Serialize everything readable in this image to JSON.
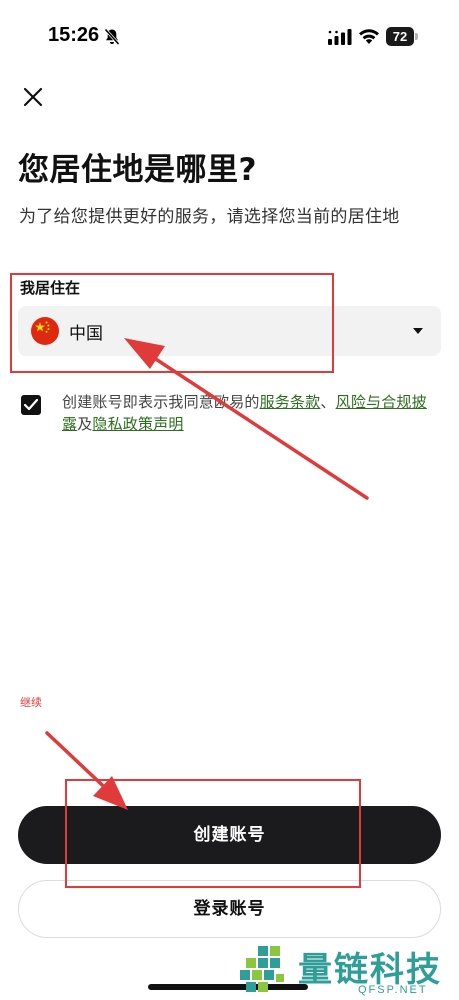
{
  "status_bar": {
    "time": "15:26",
    "battery": "72",
    "icons": [
      "bell-off-icon",
      "signal-icon",
      "wifi-icon",
      "battery-icon"
    ]
  },
  "header": {
    "close_icon": "close-icon",
    "title": "您居住地是哪里?",
    "subtitle": "为了给您提供更好的服务，请选择您当前的居住地"
  },
  "residence": {
    "label": "我居住在",
    "selected_country": "中国",
    "flag_icon": "china-flag-icon",
    "caret_icon": "caret-down-icon"
  },
  "agreement": {
    "checked": true,
    "prefix": "创建账号即表示我同意欧易的",
    "terms_link": "服务条款",
    "separator": "、",
    "risk_link": "风险与合规披露",
    "and": "及",
    "privacy_link": "隐私政策声明"
  },
  "annotation": {
    "continue_note": "继续"
  },
  "actions": {
    "create_account": "创建账号",
    "login": "登录账号"
  },
  "watermark": {
    "title": "量链科技",
    "site": "QFSP.NET"
  },
  "colors": {
    "primary_button": "#1b1b1d",
    "link": "#2b6e1c",
    "annotation_red": "#e03a3a",
    "select_bg": "#f2f2f2",
    "watermark": "#2f9e98"
  }
}
